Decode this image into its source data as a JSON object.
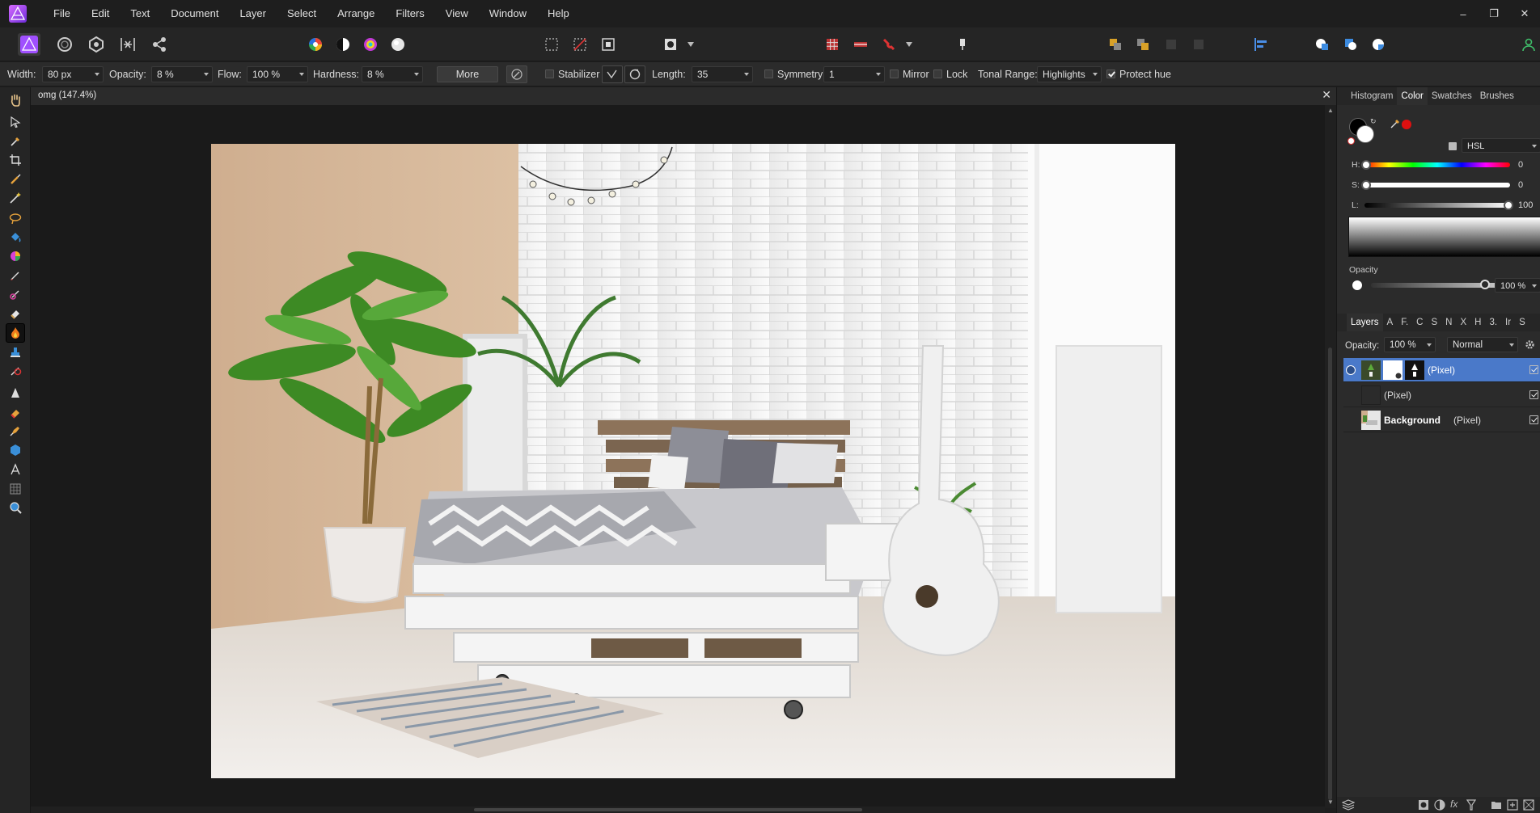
{
  "app": {
    "menu": [
      "File",
      "Edit",
      "Text",
      "Document",
      "Layer",
      "Select",
      "Arrange",
      "Filters",
      "View",
      "Window",
      "Help"
    ],
    "window_controls": {
      "minimize": "–",
      "restore": "❐",
      "close": "✕"
    }
  },
  "context_bar": {
    "width_label": "Width:",
    "width_value": "80 px",
    "opacity_label": "Opacity:",
    "opacity_value": "8 %",
    "flow_label": "Flow:",
    "flow_value": "100 %",
    "hardness_label": "Hardness:",
    "hardness_value": "8 %",
    "more_label": "More",
    "stabilizer_label": "Stabilizer",
    "stabilizer_checked": false,
    "length_label": "Length:",
    "length_value": "35",
    "symmetry_label": "Symmetry",
    "symmetry_checked": false,
    "symmetry_value": "1",
    "mirror_label": "Mirror",
    "mirror_checked": false,
    "lock_label": "Lock",
    "lock_checked": false,
    "tonal_range_label": "Tonal Range:",
    "tonal_range_value": "Highlights",
    "protect_hue_label": "Protect hue",
    "protect_hue_checked": true
  },
  "document": {
    "title": "omg (147.4%)",
    "close": "✕"
  },
  "color_panel": {
    "tabs": [
      "Histogram",
      "Color",
      "Swatches",
      "Brushes"
    ],
    "active_tab": "Color",
    "model": "HSL",
    "h_label": "H:",
    "h_value": "0",
    "s_label": "S:",
    "s_value": "0",
    "l_label": "L:",
    "l_value": "100",
    "opacity_label": "Opacity",
    "opacity_value": "100 %",
    "primary_color": "#ffffff",
    "secondary_color": "#000000",
    "swatch_accent": "#e01010"
  },
  "layers_panel": {
    "tabs": [
      "Layers",
      "A",
      "F.",
      "C",
      "S",
      "N",
      "X",
      "H",
      "3.",
      "Ir",
      "S"
    ],
    "opacity_label": "Opacity:",
    "opacity_value": "100 %",
    "blend_mode": "Normal",
    "layers": [
      {
        "name": "",
        "type": "(Pixel)",
        "selected": true
      },
      {
        "name": "",
        "type": "(Pixel)",
        "selected": false
      },
      {
        "name": "Background",
        "type": "(Pixel)",
        "selected": false
      }
    ]
  },
  "theme": {
    "accent_selection": "#4a79c9",
    "app_brand": "#8e46ff"
  }
}
